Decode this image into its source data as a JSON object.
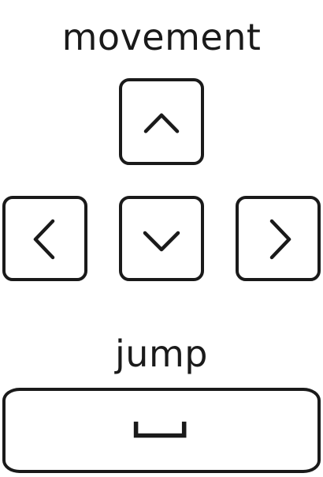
{
  "movement": {
    "title": "movement",
    "keys": [
      {
        "direction": "up",
        "icon": "chevron-up-icon"
      },
      {
        "direction": "left",
        "icon": "chevron-left-icon"
      },
      {
        "direction": "down",
        "icon": "chevron-down-icon"
      },
      {
        "direction": "right",
        "icon": "chevron-right-icon"
      }
    ]
  },
  "jump": {
    "title": "jump",
    "key": {
      "name": "space",
      "icon": "space-bar-icon"
    }
  },
  "colors": {
    "stroke": "#1a1a1a",
    "background": "#ffffff"
  }
}
